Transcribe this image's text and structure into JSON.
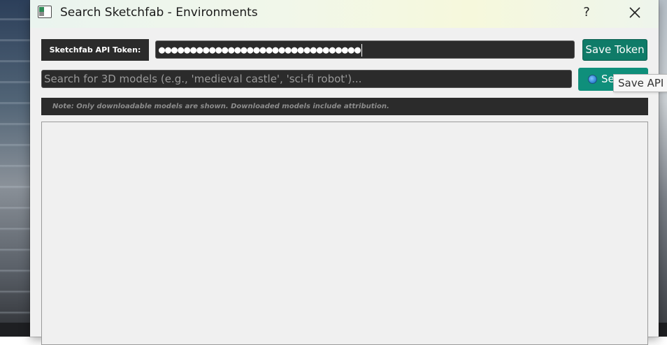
{
  "window": {
    "title": "Search Sketchfab - Environments",
    "help_label": "?",
    "icon": "app-window-icon"
  },
  "token": {
    "label": "Sketchfab API Token:",
    "masked_value": "●●●●●●●●●●●●●●●●●●●●●●●●●●●●●●●●",
    "save_label": "Save Token"
  },
  "search": {
    "placeholder": "Search for 3D models (e.g., 'medieval castle', 'sci-fi robot')...",
    "button_label": "Search",
    "button_icon": "magnifier-icon"
  },
  "note": "Note: Only downloadable models are shown. Downloaded models include attribution.",
  "tooltip": "Save API Token",
  "colors": {
    "accent": "#0f7b68",
    "search_button": "#0f8f7b",
    "dark_field": "#2b2b2b",
    "dialog_bg": "#f0f0f0"
  }
}
